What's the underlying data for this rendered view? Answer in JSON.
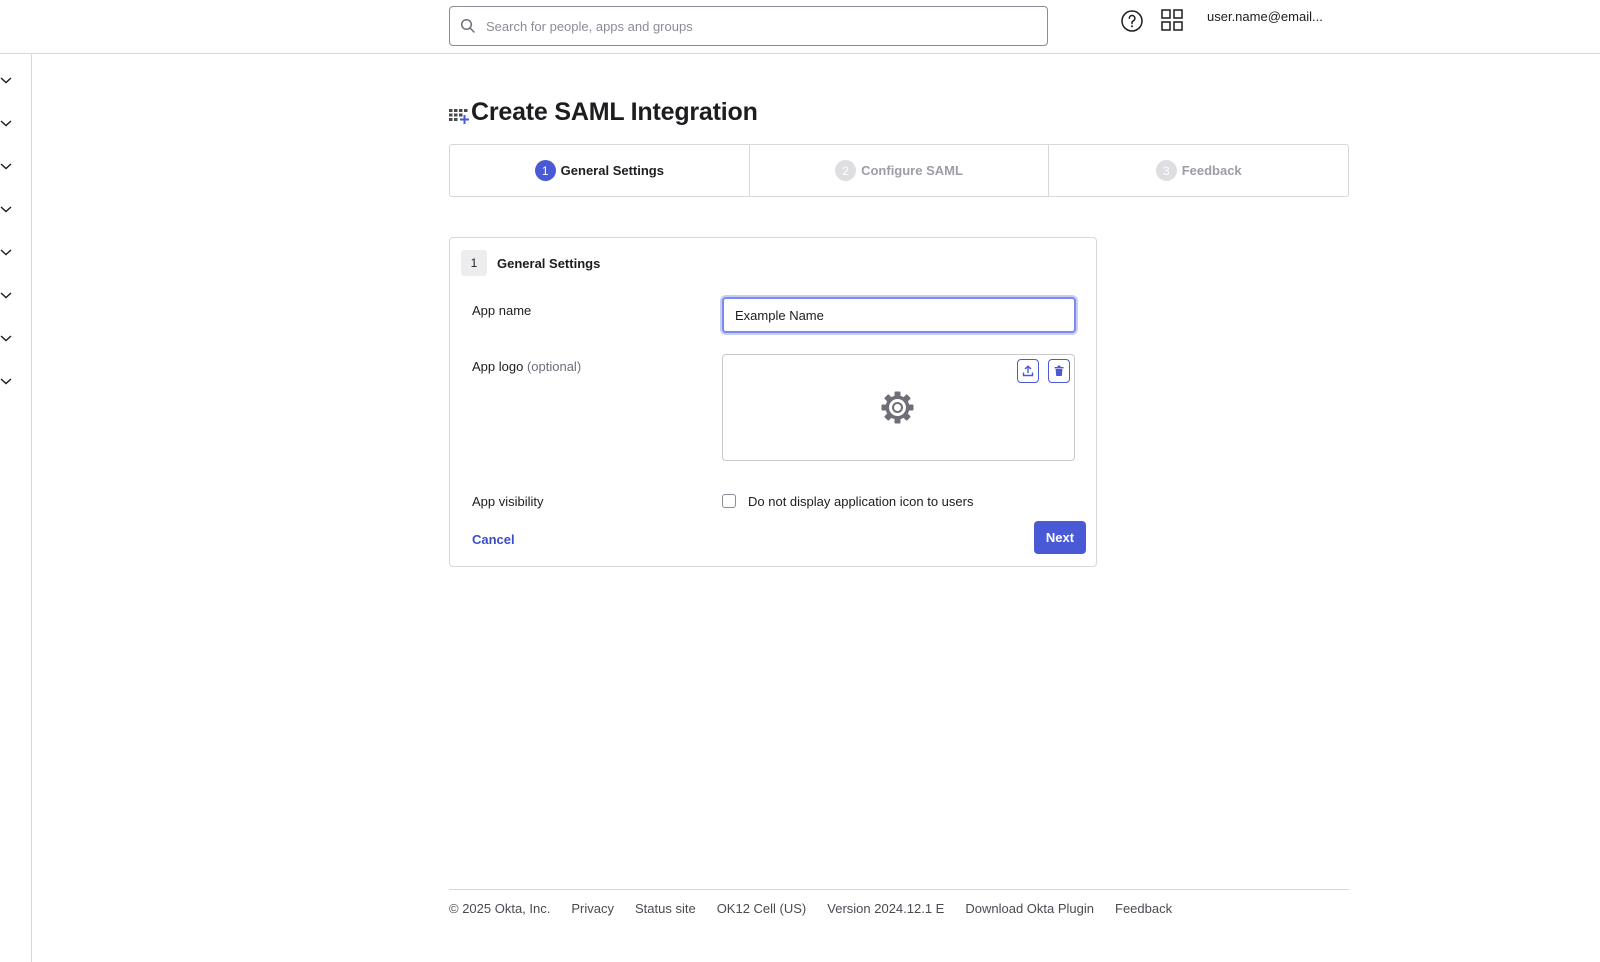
{
  "header": {
    "search_placeholder": "Search for people, apps and groups",
    "user": "user.name@email..."
  },
  "page": {
    "title": "Create SAML Integration"
  },
  "steps": [
    {
      "number": "1",
      "label": "General Settings",
      "state": "active"
    },
    {
      "number": "2",
      "label": "Configure SAML",
      "state": "inactive"
    },
    {
      "number": "3",
      "label": "Feedback",
      "state": "inactive"
    }
  ],
  "form": {
    "section_number": "1",
    "section_title": "General Settings",
    "app_name_label": "App name",
    "app_name_value": "Example Name",
    "app_logo_label": "App logo",
    "app_logo_optional": "(optional)",
    "app_visibility_label": "App visibility",
    "visibility_checkbox_label": "Do not display application icon to users",
    "cancel_label": "Cancel",
    "next_label": "Next"
  },
  "footer": {
    "copyright": "© 2025 Okta, Inc.",
    "links": [
      "Privacy",
      "Status site",
      "OK12 Cell (US)",
      "Version 2024.12.1 E",
      "Download Okta Plugin",
      "Feedback"
    ]
  },
  "colors": {
    "accent": "#4a5ad6",
    "link": "#3b4ec9",
    "border": "#d7d7dc"
  }
}
